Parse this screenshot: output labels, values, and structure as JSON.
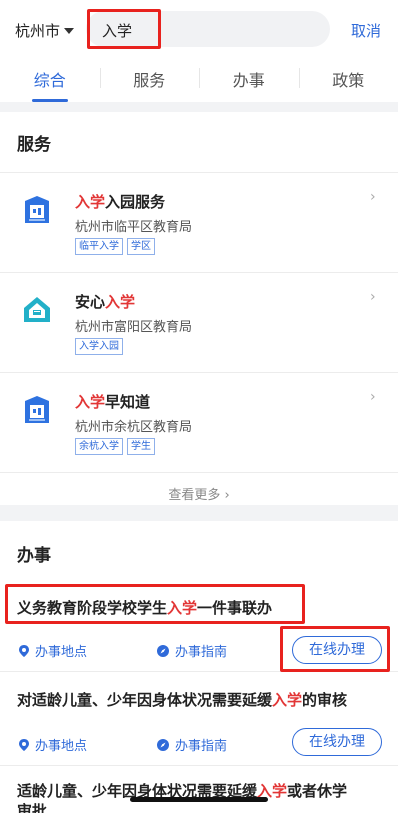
{
  "header": {
    "city": "杭州市",
    "search_value": "入学",
    "cancel": "取消"
  },
  "tabs": [
    {
      "label": "综合"
    },
    {
      "label": "服务"
    },
    {
      "label": "办事"
    },
    {
      "label": "政策"
    }
  ],
  "services": {
    "title": "服务",
    "items": [
      {
        "name_hl": "入学",
        "name_rest": "入园服务",
        "dept": "杭州市临平区教育局",
        "tags": [
          "临平入学",
          "学区"
        ],
        "icon": "building-icon"
      },
      {
        "name_pre": "安心",
        "name_hl": "入学",
        "dept": "杭州市富阳区教育局",
        "tags": [
          "入学入园"
        ],
        "icon": "house-icon"
      },
      {
        "name_hl": "入学",
        "name_rest": "早知道",
        "dept": "杭州市余杭区教育局",
        "tags": [
          "余杭入学",
          "学生"
        ],
        "icon": "building-icon"
      }
    ],
    "more": "查看更多 ›"
  },
  "affairs": {
    "title": "办事",
    "items": [
      {
        "title_pre": "义务教育阶段学校学生",
        "title_hl": "入学",
        "title_post": "一件事联办",
        "location": "办事地点",
        "guide": "办事指南",
        "action": "在线办理"
      },
      {
        "title_pre": "对适龄儿童、少年因身体状况需要延缓",
        "title_hl": "入学",
        "title_post": "的审核",
        "location": "办事地点",
        "guide": "办事指南",
        "action": "在线办理"
      },
      {
        "title_pre": "适龄儿童、少年因身体状况需要延缓",
        "title_hl": "入学",
        "title_post": "或者休学",
        "title_line2": "审批"
      }
    ]
  },
  "colors": {
    "accent": "#2f6ad9",
    "highlight": "#e23636",
    "annotation": "#e8221e"
  }
}
